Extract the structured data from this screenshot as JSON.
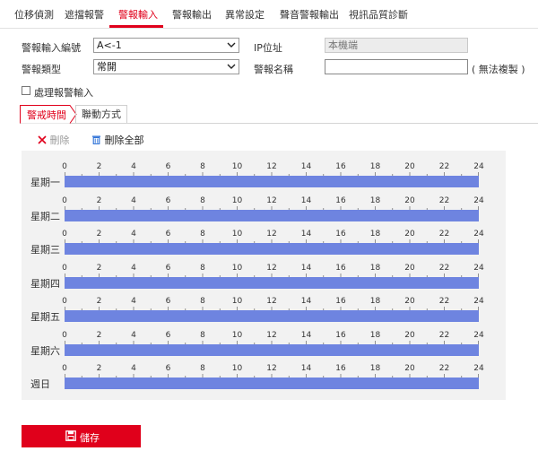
{
  "tabs": [
    {
      "label": "位移偵測"
    },
    {
      "label": "遮擋報警"
    },
    {
      "label": "警報輸入"
    },
    {
      "label": "警報輸出"
    },
    {
      "label": "異常設定"
    },
    {
      "label": "聲音警報輸出"
    },
    {
      "label": "視訊品質診斷"
    }
  ],
  "active_tab": "警報輸入",
  "form": {
    "alarm_input_no_label": "警報輸入編號",
    "alarm_input_no_value": "A<-1",
    "ip_label": "IP位址",
    "ip_value": "本機端",
    "alarm_type_label": "警報類型",
    "alarm_type_value": "常開",
    "alarm_name_label": "警報名稱",
    "alarm_name_value": "",
    "alarm_name_note": "( 無法複製 )",
    "handle_label": "處理報警輸入"
  },
  "subtabs": [
    {
      "label": "警戒時間"
    },
    {
      "label": "聯動方式"
    }
  ],
  "actions": {
    "delete_label": "刪除",
    "delete_all_label": "刪除全部"
  },
  "schedule": {
    "hour_labels": [
      "0",
      "2",
      "4",
      "6",
      "8",
      "10",
      "12",
      "14",
      "16",
      "18",
      "20",
      "22",
      "24"
    ],
    "days": [
      {
        "label": "星期一"
      },
      {
        "label": "星期二"
      },
      {
        "label": "星期三"
      },
      {
        "label": "星期四"
      },
      {
        "label": "星期五"
      },
      {
        "label": "星期六"
      },
      {
        "label": "週日"
      }
    ]
  },
  "save_label": "儲存",
  "colors": {
    "accent": "#e0001b",
    "schedule_bar": "#6e84e0",
    "delete_icon": "#e0001b",
    "delete_all_icon": "#2a6fd6"
  }
}
